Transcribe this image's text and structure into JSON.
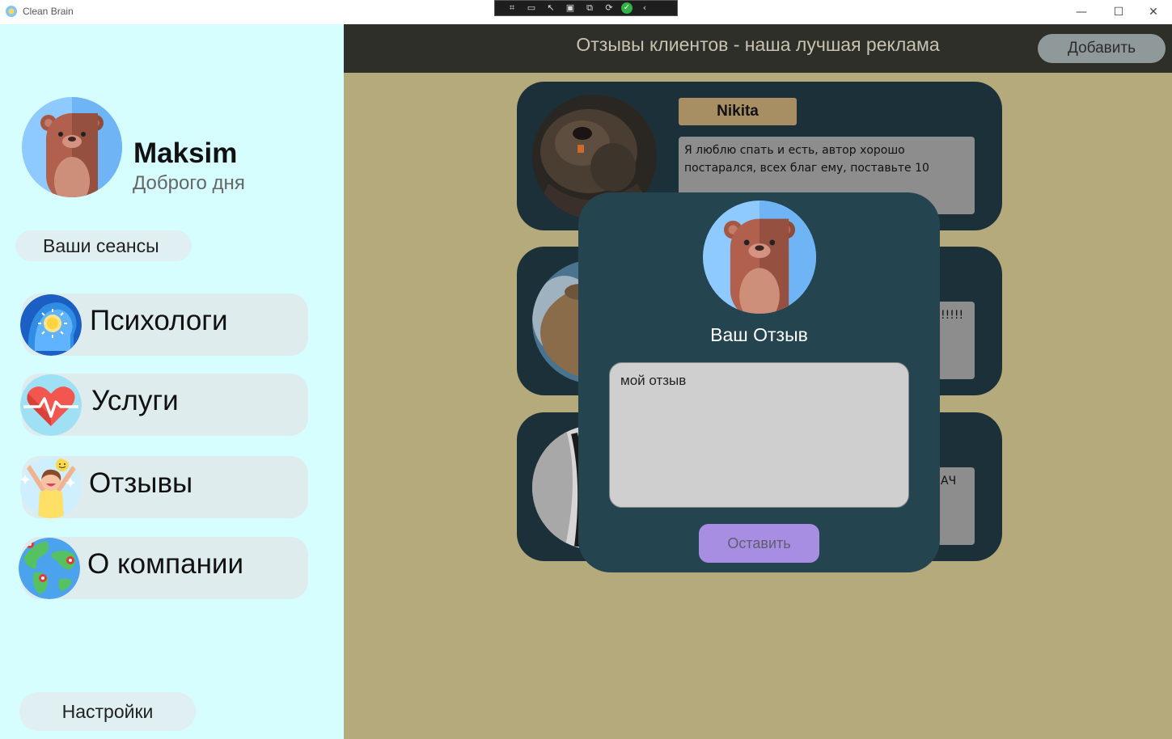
{
  "window": {
    "title": "Clean Brain",
    "controls": {
      "minimize": "—",
      "maximize": "☐",
      "close": "✕"
    }
  },
  "debug_toolbar": {
    "icons": [
      "inspect-icon",
      "record-icon",
      "select-icon",
      "layout-icon",
      "track-icon",
      "hot-reload-icon",
      "check-icon",
      "collapse-icon"
    ]
  },
  "sidebar": {
    "user": {
      "name": "Maksim",
      "greeting": "Доброго дня"
    },
    "sessions_label": "Ваши сеансы",
    "nav": [
      {
        "label": "Психологи",
        "icon": "brain-sun-icon"
      },
      {
        "label": "Услуги",
        "icon": "heart-pulse-icon"
      },
      {
        "label": "Отзывы",
        "icon": "happy-person-icon"
      },
      {
        "label": "О компании",
        "icon": "globe-pins-icon"
      }
    ],
    "settings_label": "Настройки"
  },
  "main": {
    "heading": "Отзывы клиентов - наша лучшая реклама",
    "add_label": "Добавить",
    "reviews": [
      {
        "author": "Nikita",
        "text": "Я люблю спать и есть, автор хорошо постарался, всех благ ему, поставьте 10",
        "photo": "beaver-photo"
      },
      {
        "author": "",
        "text": "!!!!!",
        "photo": "capybara-photo"
      },
      {
        "author": "",
        "text": "АЧ",
        "photo": "grayscale-photo"
      }
    ]
  },
  "modal": {
    "title": "Ваш Отзыв",
    "input_value": "мой отзыв",
    "submit_label": "Оставить"
  },
  "colors": {
    "sidebar_bg": "#d6fdff",
    "main_bg": "#b5aa7c",
    "topbar_bg": "#2f2f2a",
    "card_bg": "#1b3038",
    "modal_bg": "#244550",
    "author_tag": "#a88e63",
    "submit_btn": "#a78ee2"
  }
}
